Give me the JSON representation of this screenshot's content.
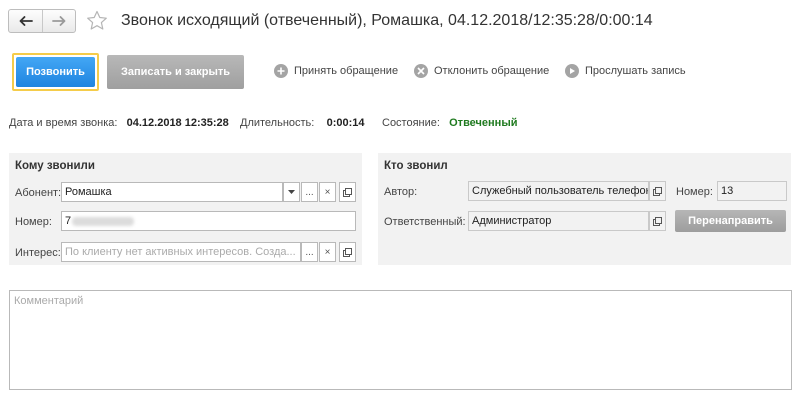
{
  "window": {
    "title": "Звонок исходящий (отвеченный), Ромашка, 04.12.2018/12:35:28/0:00:14"
  },
  "toolbar": {
    "call_label": "Позвонить",
    "save_close_label": "Записать и закрыть",
    "accept_label": "Принять обращение",
    "reject_label": "Отклонить обращение",
    "listen_label": "Прослушать запись"
  },
  "info": {
    "datetime_label": "Дата и время звонка:",
    "datetime_value": "04.12.2018 12:35:28",
    "duration_label": "Длительность:",
    "duration_value": "0:00:14",
    "state_label": "Состояние:",
    "state_value": "Отвеченный"
  },
  "called": {
    "title": "Кому звонили",
    "subscriber_label": "Абонент:",
    "subscriber_value": "Ромашка",
    "number_label": "Номер:",
    "number_value": "7",
    "interest_label": "Интерес:",
    "interest_placeholder": "По клиенту нет активных интересов. Созда..."
  },
  "caller": {
    "title": "Кто звонил",
    "author_label": "Автор:",
    "author_value": "Служебный пользователь телефон",
    "number_label": "Номер:",
    "number_value": "13",
    "responsible_label": "Ответственный:",
    "responsible_value": "Администратор",
    "redirect_label": "Перенаправить"
  },
  "comment": {
    "placeholder": "Комментарий"
  },
  "glyphs": {
    "dots": "...",
    "clear": "×"
  },
  "colors": {
    "primary_button": "#2b90e8",
    "status_ok": "#1f7a1f",
    "highlight_border": "#f5cc4a"
  }
}
